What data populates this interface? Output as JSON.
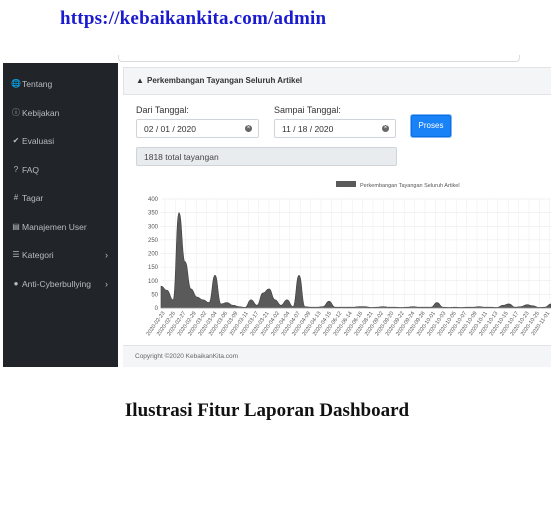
{
  "header_url": "https://kebaikankita.com/admin",
  "caption": "Ilustrasi Fitur Laporan Dashboard",
  "sidebar": {
    "items": [
      {
        "label": "Tentang",
        "icon": "globe-icon",
        "glyph": "🌐",
        "has_submenu": false
      },
      {
        "label": "Kebijakan",
        "icon": "info-icon",
        "glyph": "ⓘ",
        "has_submenu": false
      },
      {
        "label": "Evaluasi",
        "icon": "check-circle-icon",
        "glyph": "✔",
        "has_submenu": false
      },
      {
        "label": "FAQ",
        "icon": "question-icon",
        "glyph": "?",
        "has_submenu": false
      },
      {
        "label": "Tagar",
        "icon": "hashtag-icon",
        "glyph": "#",
        "has_submenu": false
      },
      {
        "label": "Manajemen User",
        "icon": "id-card-icon",
        "glyph": "▤",
        "has_submenu": false
      },
      {
        "label": "Kategori",
        "icon": "list-icon",
        "glyph": "☰",
        "has_submenu": true
      },
      {
        "label": "Anti-Cyberbullying",
        "icon": "comments-icon",
        "glyph": "●",
        "has_submenu": true
      }
    ],
    "chevron": "›"
  },
  "card": {
    "title": "Perkembangan Tayangan Seluruh Artikel",
    "icon": "area-chart-icon",
    "icon_glyph": "▲"
  },
  "form": {
    "from_label": "Dari Tanggal:",
    "from_value": "02 / 01 / 2020",
    "to_label": "Sampai Tanggal:",
    "to_value": "11 / 18 / 2020",
    "clear_glyph": "×",
    "submit_label": "Proses",
    "total": "1818 total tayangan"
  },
  "footer": "Copyright ©2020 KebaikanKita.com",
  "colors": {
    "sidebar": "#212529",
    "accent": "#1a82f7",
    "area": "#5a5a5a"
  },
  "chart_data": {
    "type": "area",
    "legend": "Perkembangan Tayangan Seluruh Artikel",
    "legend_position": "top",
    "ylim": [
      0,
      400
    ],
    "yticks": [
      0,
      50,
      100,
      150,
      200,
      250,
      300,
      350,
      400
    ],
    "grid": true,
    "x_labels": [
      "2020-02-23",
      "2020-02-25",
      "2020-02-27",
      "2020-02-29",
      "2020-03-02",
      "2020-03-04",
      "2020-03-06",
      "2020-03-09",
      "2020-03-11",
      "2020-03-17",
      "2020-03-21",
      "2020-04-02",
      "2020-04-04",
      "2020-04-07",
      "2020-04-09",
      "2020-04-13",
      "2020-04-15",
      "2020-06-12",
      "2020-06-14",
      "2020-06-16",
      "2020-08-21",
      "2020-09-02",
      "2020-09-20",
      "2020-09-22",
      "2020-09-24",
      "2020-09-28",
      "2020-10-01",
      "2020-10-03",
      "2020-10-05",
      "2020-10-07",
      "2020-10-09",
      "2020-10-11",
      "2020-10-13",
      "2020-10-15",
      "2020-10-17",
      "2020-10-23",
      "2020-10-25",
      "2020-11-01"
    ],
    "values": [
      80,
      65,
      30,
      350,
      170,
      70,
      40,
      30,
      20,
      120,
      15,
      20,
      10,
      5,
      2,
      30,
      10,
      55,
      70,
      30,
      10,
      30,
      5,
      120,
      5,
      3,
      3,
      5,
      25,
      3,
      3,
      3,
      3,
      5,
      5,
      2,
      3,
      5,
      3,
      3,
      2,
      3,
      5,
      3,
      3,
      3,
      20,
      3,
      2,
      3,
      2,
      3,
      3,
      5,
      3,
      3,
      2,
      10,
      15,
      3,
      5,
      12,
      8,
      2,
      3,
      15
    ]
  }
}
